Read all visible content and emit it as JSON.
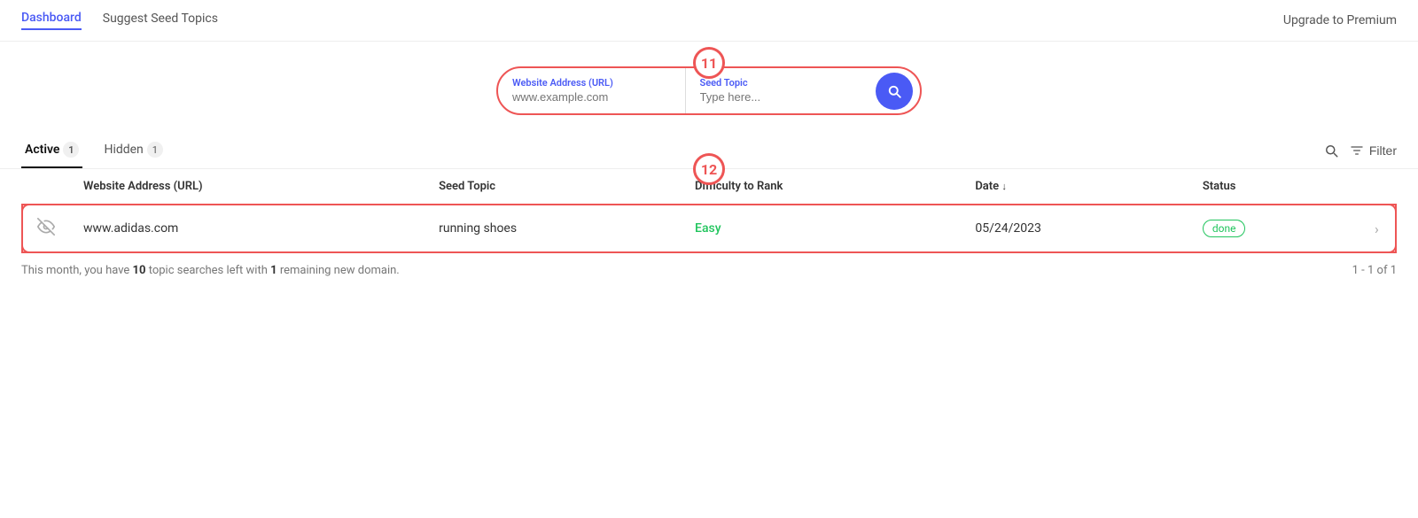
{
  "nav": {
    "items": [
      {
        "label": "Dashboard",
        "active": true
      },
      {
        "label": "Suggest Seed Topics",
        "active": false
      }
    ],
    "upgrade_label": "Upgrade to Premium"
  },
  "search": {
    "url_label": "Website Address (URL)",
    "url_placeholder": "www.example.com",
    "topic_label": "Seed Topic",
    "topic_placeholder": "Type here...",
    "annotation_number": "11"
  },
  "tabs": {
    "items": [
      {
        "label": "Active",
        "count": "1",
        "active": true
      },
      {
        "label": "Hidden",
        "count": "1",
        "active": false
      }
    ]
  },
  "filter": {
    "search_icon": "🔍",
    "filter_label": "Filter"
  },
  "table": {
    "annotation_number": "12",
    "columns": [
      {
        "label": ""
      },
      {
        "label": "Website Address (URL)"
      },
      {
        "label": "Seed Topic"
      },
      {
        "label": "Difficulty to Rank"
      },
      {
        "label": "Date"
      },
      {
        "label": "Status"
      },
      {
        "label": ""
      }
    ],
    "rows": [
      {
        "hidden_icon": true,
        "url": "www.adidas.com",
        "seed_topic": "running shoes",
        "difficulty": "Easy",
        "date": "05/24/2023",
        "status": "done"
      }
    ]
  },
  "footer": {
    "searches_text": "This month, you have",
    "searches_count": "10",
    "searches_suffix": "topic searches left with",
    "domain_count": "1",
    "domain_suffix": "remaining new domain.",
    "pagination": "1 - 1 of 1"
  }
}
